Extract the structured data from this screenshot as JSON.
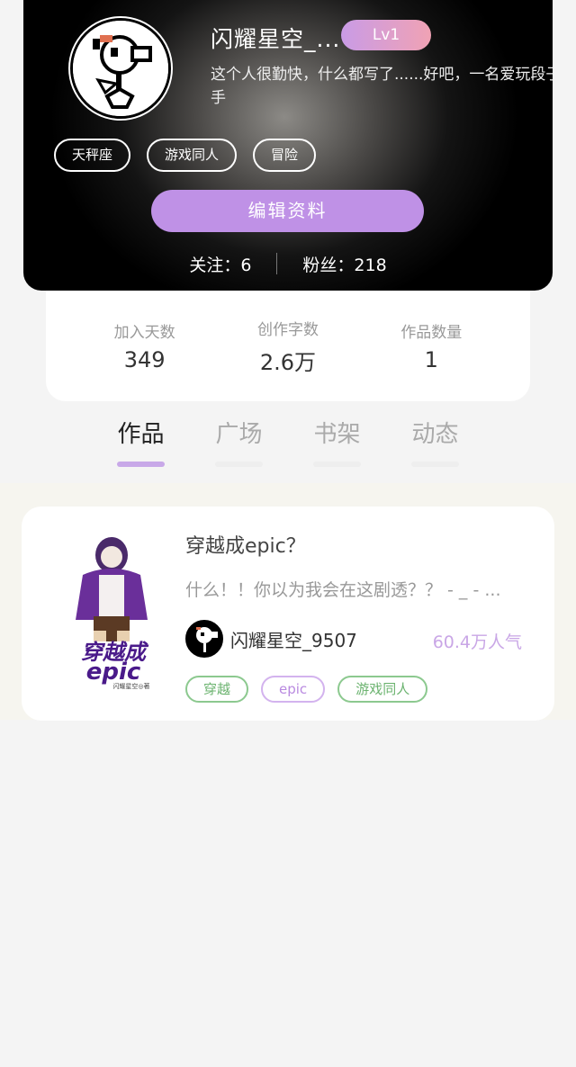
{
  "profile": {
    "username": "闪耀星空_...",
    "level": "Lv1",
    "bio": "这个人很勤快，什么都写了......好吧，一名爱玩段子手",
    "tags": [
      "天秤座",
      "游戏同人",
      "冒险"
    ],
    "edit_label": "编辑资料",
    "follow_label": "关注：6",
    "fans_label": "粉丝：218"
  },
  "stats": [
    {
      "label": "加入天数",
      "value": "349"
    },
    {
      "label": "创作字数",
      "value": "2.6万"
    },
    {
      "label": "作品数量",
      "value": "1"
    }
  ],
  "tabs": [
    {
      "label": "作品",
      "active": true
    },
    {
      "label": "广场",
      "active": false
    },
    {
      "label": "书架",
      "active": false
    },
    {
      "label": "动态",
      "active": false
    }
  ],
  "works": [
    {
      "title": "穿越成epic？",
      "description": "什么！！你以为我会在这剧透？？ - _ - ...",
      "author": "闪耀星空_9507",
      "popularity": "60.4万人气",
      "cover_text": "穿越成",
      "cover_subtext": "epic",
      "cover_byline": "闪耀星空◎著",
      "tags": [
        "穿越",
        "epic",
        "游戏同人"
      ]
    }
  ],
  "colors": {
    "accent": "#bf91e6",
    "tag_green": "#6bb36f",
    "tag_purple": "#b98ae0"
  }
}
